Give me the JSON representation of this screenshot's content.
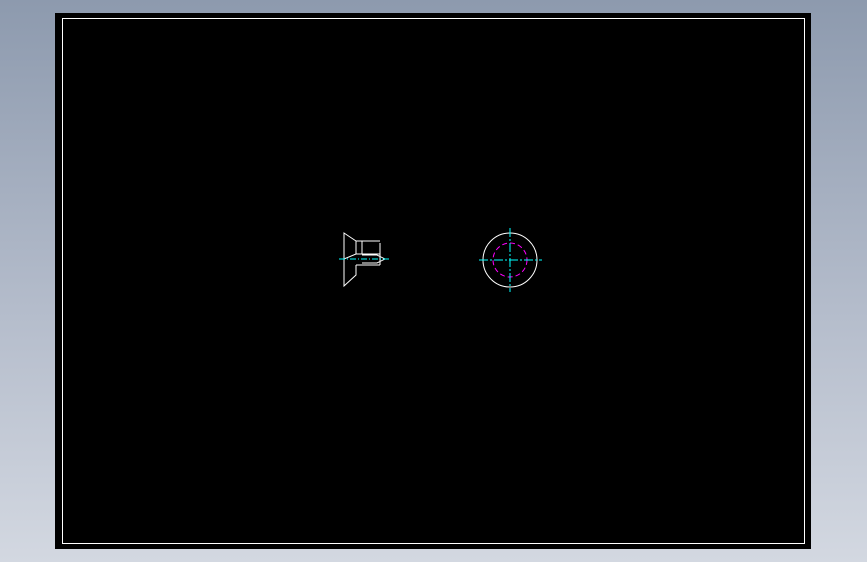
{
  "drawing": {
    "background_color": "#000000",
    "frame_color": "#ffffff",
    "outline_color": "#ffffff",
    "centerline_color": "#00ffff",
    "hidden_circle_color": "#ff00ff"
  }
}
